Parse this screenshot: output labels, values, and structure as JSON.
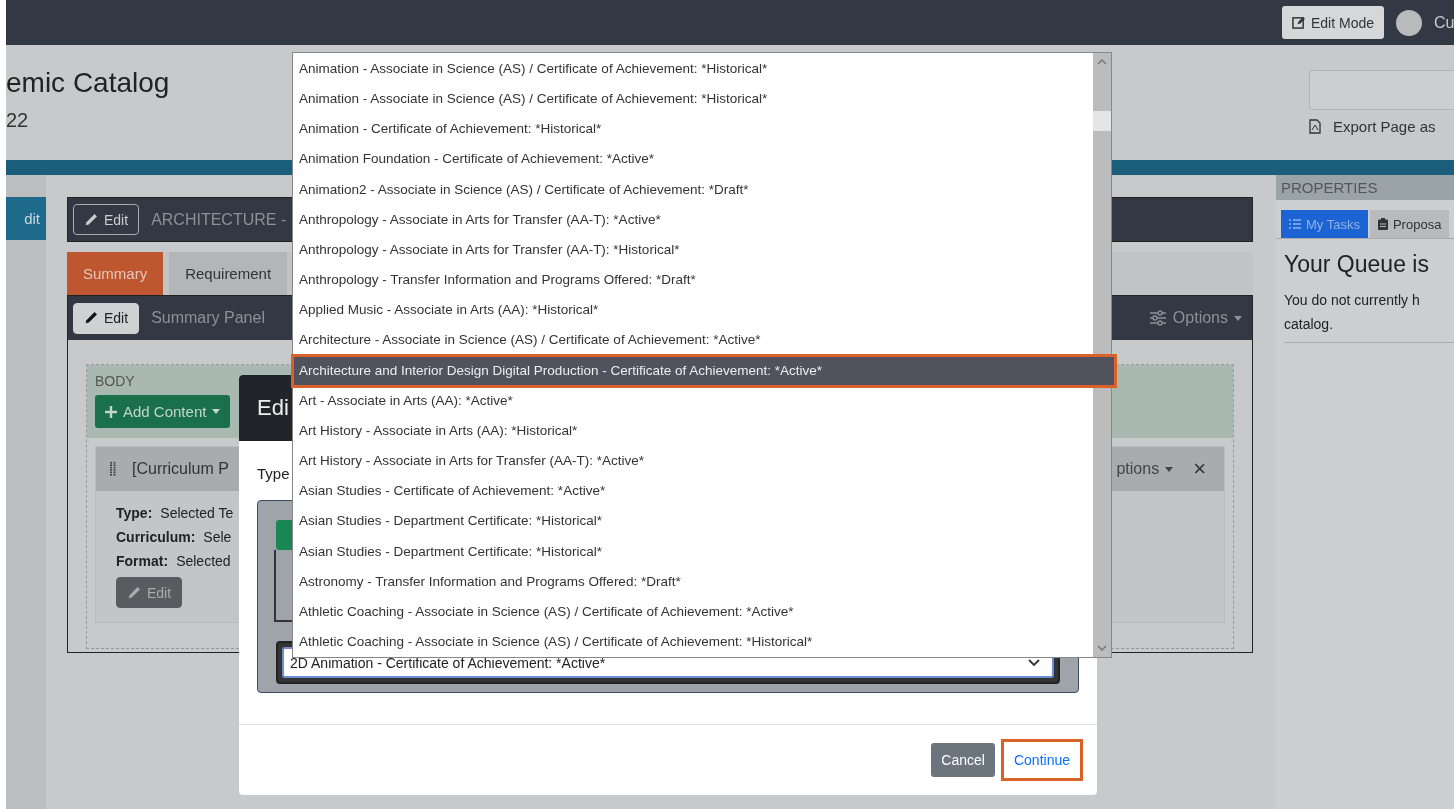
{
  "top_bar": {
    "edit_mode_button": "Edit Mode",
    "user_name": "Cu"
  },
  "header": {
    "title": "emic Catalog",
    "subtitle": "22",
    "export_link": "Export Page as"
  },
  "sidebar": {
    "button": "dit"
  },
  "program_header": {
    "edit_button": "Edit",
    "title": "ARCHITECTURE -"
  },
  "tabs": [
    {
      "label": "Summary",
      "selected": true
    },
    {
      "label": "Requirement",
      "selected": false
    }
  ],
  "panel": {
    "edit_button": "Edit",
    "title": "Summary Panel",
    "options_menu": "Options",
    "body": {
      "label": "BODY",
      "add_button": "Add Content",
      "card": {
        "title": "[Curriculum P",
        "options_menu": "ptions",
        "close": "×",
        "fields": [
          {
            "label": "Type:",
            "value": "Selected Te"
          },
          {
            "label": "Curriculum:",
            "value": "Sele"
          },
          {
            "label": "Format:",
            "value": "Selected"
          }
        ],
        "edit_button": "Edit"
      }
    }
  },
  "properties": {
    "title": "PROPERTIES",
    "tabs": [
      {
        "label": "My Tasks",
        "selected": true
      },
      {
        "label": "Proposa",
        "selected": false
      }
    ],
    "heading": "Your Queue is",
    "text": "You do not currently h",
    "text_2": "catalog."
  },
  "modal": {
    "title": "Edi",
    "type_label": "Type",
    "select_value": "2D Animation - Certificate of Achievement: *Active*",
    "buttons": [
      {
        "label": "Cancel",
        "kind": "secondary",
        "outlined": false
      },
      {
        "label": "Continue",
        "kind": "link",
        "outlined": true
      }
    ]
  },
  "dropdown": {
    "options": [
      {
        "label": "Animation - Associate in Science (AS) / Certificate of Achievement: *Historical*",
        "selected": false
      },
      {
        "label": "Animation - Associate in Science (AS) / Certificate of Achievement: *Historical*",
        "selected": false
      },
      {
        "label": "Animation - Certificate of Achievement: *Historical*",
        "selected": false
      },
      {
        "label": "Animation Foundation - Certificate of Achievement: *Active*",
        "selected": false
      },
      {
        "label": "Animation2 - Associate in Science (AS) / Certificate of Achievement: *Draft*",
        "selected": false
      },
      {
        "label": "Anthropology - Associate in Arts for Transfer (AA-T): *Active*",
        "selected": false
      },
      {
        "label": "Anthropology - Associate in Arts for Transfer (AA-T): *Historical*",
        "selected": false
      },
      {
        "label": "Anthropology - Transfer Information and Programs Offered: *Draft*",
        "selected": false
      },
      {
        "label": "Applied Music - Associate in Arts (AA): *Historical*",
        "selected": false
      },
      {
        "label": "Architecture - Associate in Science (AS) / Certificate of Achievement: *Active*",
        "selected": false
      },
      {
        "label": "Architecture and Interior Design Digital Production - Certificate of Achievement: *Active*",
        "selected": true
      },
      {
        "label": "Art - Associate in Arts (AA): *Active*",
        "selected": false
      },
      {
        "label": "Art History - Associate in Arts (AA): *Historical*",
        "selected": false
      },
      {
        "label": "Art History - Associate in Arts for Transfer (AA-T): *Active*",
        "selected": false
      },
      {
        "label": "Asian Studies - Certificate of Achievement: *Active*",
        "selected": false
      },
      {
        "label": "Asian Studies - Department Certificate: *Historical*",
        "selected": false
      },
      {
        "label": "Asian Studies - Department Certificate: *Historical*",
        "selected": false
      },
      {
        "label": "Astronomy - Transfer Information and Programs Offered: *Draft*",
        "selected": false
      },
      {
        "label": "Athletic Coaching - Associate in Science (AS) / Certificate of Achievement: *Active*",
        "selected": false
      },
      {
        "label": "Athletic Coaching - Associate in Science (AS) / Certificate of Achievement: *Historical*",
        "selected": false
      }
    ]
  }
}
